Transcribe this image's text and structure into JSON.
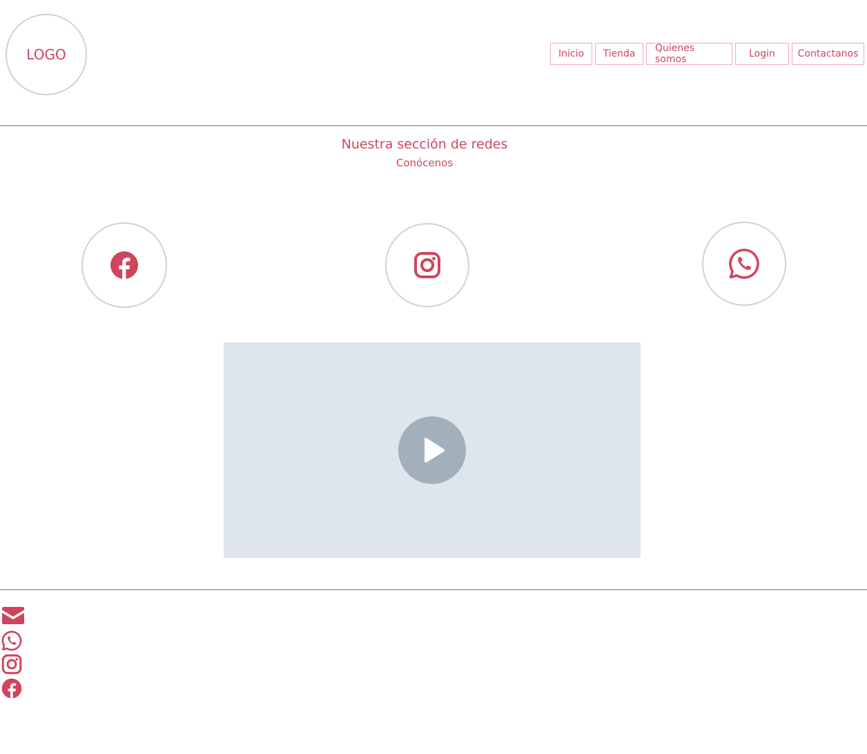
{
  "header": {
    "logo_text": "LOGO",
    "nav": [
      {
        "label": "Inicio"
      },
      {
        "label": "Tienda"
      },
      {
        "label": "Quienes somos"
      },
      {
        "label": "Login"
      },
      {
        "label": "Contactanos"
      }
    ]
  },
  "section": {
    "title": "Nuestra sección de redes",
    "subtitle": "Conócenos"
  },
  "social": [
    {
      "icon": "facebook-icon"
    },
    {
      "icon": "instagram-icon"
    },
    {
      "icon": "whatsapp-icon"
    }
  ],
  "video": {
    "icon": "play-icon"
  },
  "footer": {
    "icons": [
      "mail-icon",
      "whatsapp-icon",
      "instagram-icon",
      "facebook-icon"
    ]
  },
  "colors": {
    "accent": "#d0445c",
    "border": "#c9d3de",
    "divider": "#a9b4bf",
    "video_bg": "#dfe5ec",
    "play_bg": "#a2b0bc"
  }
}
